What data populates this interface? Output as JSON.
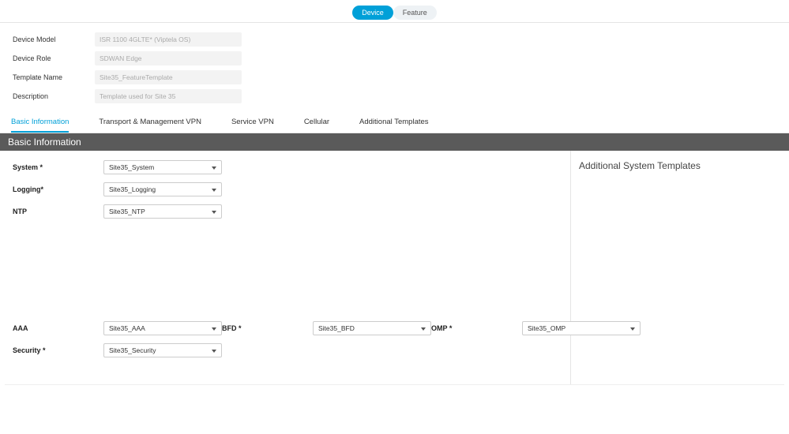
{
  "toggles": {
    "device": "Device",
    "feature": "Feature"
  },
  "fields": {
    "device_model_label": "Device Model",
    "device_model_value": "ISR 1100 4GLTE* (Viptela OS)",
    "device_role_label": "Device Role",
    "device_role_value": "SDWAN Edge",
    "template_name_label": "Template Name",
    "template_name_value": "Site35_FeatureTemplate",
    "description_label": "Description",
    "description_value": "Template used for Site 35"
  },
  "tabs": {
    "basic": "Basic Information",
    "transport": "Transport & Management VPN",
    "service": "Service VPN",
    "cellular": "Cellular",
    "additional": "Additional Templates"
  },
  "section_title": "Basic Information",
  "additional_title": "Additional System Templates",
  "basic": {
    "system_label": "System *",
    "system_value": "Site35_System",
    "logging_label": "Logging*",
    "logging_value": "Site35_Logging",
    "ntp_label": "NTP",
    "ntp_value": "Site35_NTP",
    "aaa_label": "AAA",
    "aaa_value": "Site35_AAA",
    "security_label": "Security *",
    "security_value": "Site35_Security",
    "bfd_label": "BFD *",
    "bfd_value": "Site35_BFD",
    "omp_label": "OMP *",
    "omp_value": "Site35_OMP"
  }
}
